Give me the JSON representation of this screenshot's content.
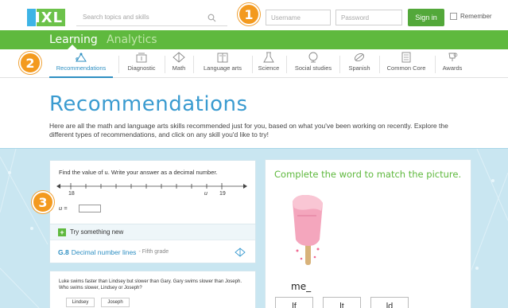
{
  "header": {
    "logo_text": "IXL",
    "search_placeholder": "Search topics and skills",
    "username_placeholder": "Username",
    "password_placeholder": "Password",
    "signin_label": "Sign in",
    "remember_label": "Remember"
  },
  "badges": [
    "1",
    "2",
    "3"
  ],
  "main_nav": {
    "tabs": [
      {
        "label": "Learning",
        "active": true
      },
      {
        "label": "Analytics",
        "active": false
      }
    ]
  },
  "sub_nav": {
    "items": [
      {
        "label": "Recommendations",
        "icon": "recommendations-icon",
        "active": true
      },
      {
        "label": "Diagnostic",
        "icon": "diagnostic-icon"
      },
      {
        "label": "Math",
        "icon": "math-icon"
      },
      {
        "label": "Language arts",
        "icon": "language-arts-icon"
      },
      {
        "label": "Science",
        "icon": "science-icon"
      },
      {
        "label": "Social studies",
        "icon": "social-studies-icon"
      },
      {
        "label": "Spanish",
        "icon": "spanish-icon"
      },
      {
        "label": "Common Core",
        "icon": "common-core-icon"
      },
      {
        "label": "Awards",
        "icon": "awards-icon"
      }
    ]
  },
  "page": {
    "title": "Recommendations",
    "intro": "Here are all the math and language arts skills recommended just for you, based on what you've been working on recently. Explore the different types of recommendations, and click on any skill you'd like to try!"
  },
  "card_math": {
    "question": "Find the value of u. Write your answer as a decimal number.",
    "numline_start": "18",
    "numline_u": "u",
    "numline_end": "19",
    "answer_label": "u =",
    "try_label": "Try something new",
    "skill_code": "G.8",
    "skill_name": "Decimal number lines",
    "skill_grade": "- Fifth grade"
  },
  "card_logic": {
    "question": "Luke swims faster than Lindsey but slower than Gary. Gary swims slower than Joseph. Who swims slower, Lindsey or Joseph?",
    "options": [
      "Lindsey",
      "Joseph"
    ]
  },
  "card_word": {
    "title": "Complete the word to match the picture.",
    "partial_word": "me_",
    "answers": [
      "lf",
      "lt",
      "ld"
    ]
  },
  "colors": {
    "green": "#5fb93e",
    "blue_title": "#3a9bd0",
    "badge_orange": "#f39a1f",
    "content_bg": "#c9e6f1"
  }
}
